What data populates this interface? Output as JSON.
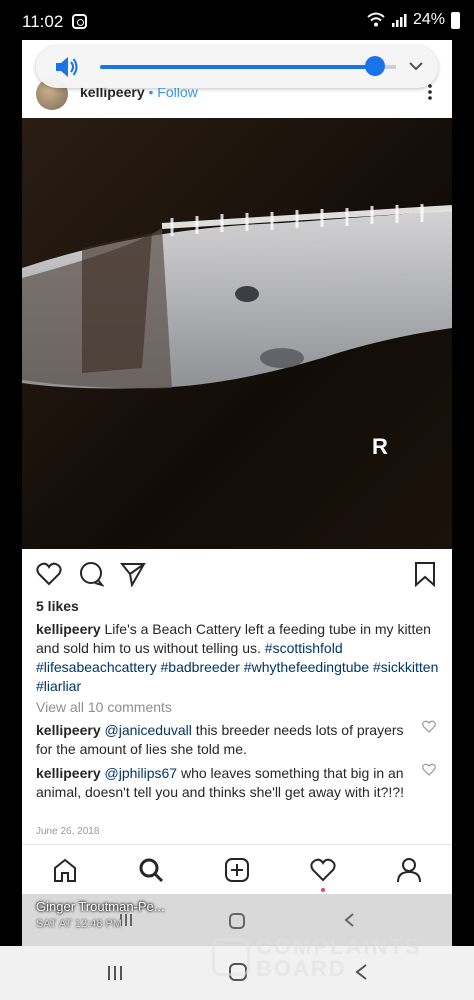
{
  "status": {
    "time": "11:02",
    "battery": "24%"
  },
  "post": {
    "username": "kellipeery",
    "follow_label": "Follow",
    "image_marker": "R",
    "likes": "5 likes",
    "caption_user": "kellipeery",
    "caption_text": "Life's a Beach Cattery left a feeding tube in my kitten and sold him to us without telling us.",
    "hashtags": "#scottishfold #lifesabeachcattery #badbreeder #whythefeedingtube #sickkitten #liarliar",
    "view_all": "View all 10 comments",
    "comments": [
      {
        "user": "kellipeery",
        "mention": "@janiceduvall",
        "text": "this breeder needs lots of prayers for the amount of lies she told me."
      },
      {
        "user": "kellipeery",
        "mention": "@jphilips67",
        "text": "who leaves something that big in an animal, doesn't tell you and thinks she'll get away with it?!?!"
      }
    ],
    "date": "June 26, 2018"
  },
  "volume": {
    "level": 0.93,
    "accent": "#1a73e8"
  },
  "overlay": {
    "name": "Ginger Troutman-Pe...",
    "time": "SAT AT 12:48 PM"
  },
  "watermark": {
    "line1": "COMPLAINTS",
    "line2": "BOARD"
  },
  "icons": [
    "speaker-icon",
    "chevron-down-icon",
    "more-icon",
    "heart-icon",
    "comment-icon",
    "share-icon",
    "bookmark-icon",
    "home-icon",
    "search-icon",
    "add-icon",
    "activity-icon",
    "profile-icon",
    "recents-icon",
    "home-button-icon",
    "back-icon"
  ]
}
